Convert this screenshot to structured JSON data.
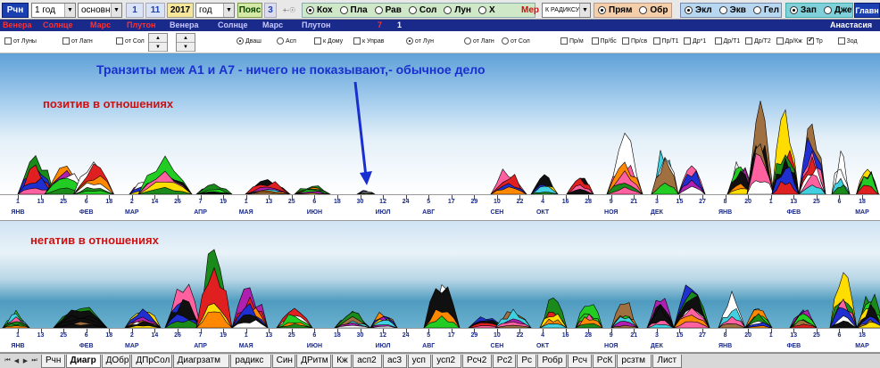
{
  "toolbar": {
    "app_button": "Рчн",
    "period_value": "1 год",
    "mode_value": "основн",
    "day": "1",
    "month": "11",
    "year": "2017",
    "unit_value": "год",
    "belt_label": "Пояс",
    "belt_value": "3",
    "hour_symbol": "+-☉",
    "house_systems": [
      "Кох",
      "Пла",
      "Рав",
      "Сол",
      "Лун",
      "X"
    ],
    "house_selected": "Кох",
    "mer_label": "Мер",
    "radix_value": "К РАДИКСУ",
    "direction": [
      "Прям",
      "Обр"
    ],
    "direction_selected": "Прям",
    "coords": [
      "Экл",
      "Экв",
      "Гел"
    ],
    "coords_selected": "Экл",
    "side": [
      "Зап",
      "Джет"
    ],
    "side_selected": "Зап",
    "main_label": "Главн"
  },
  "planet_row": {
    "left_red": [
      "Венера",
      "Солнце",
      "Марс",
      "Плутон"
    ],
    "left_white": [
      "Плутон",
      "Венера",
      "Солнце",
      "Марс",
      "Плутон"
    ],
    "red_num": "7",
    "white_num": "1",
    "name": "Анастасия"
  },
  "options": {
    "checks": [
      {
        "label": "от Луны",
        "checked": false
      },
      {
        "label": "от Лагн",
        "checked": false
      },
      {
        "label": "от Сол",
        "checked": false
      }
    ],
    "radios": [
      {
        "label": "Дваш",
        "checked": true
      },
      {
        "label": "Асп",
        "checked": false
      }
    ],
    "checks2": [
      {
        "label": "к Дому",
        "checked": false
      },
      {
        "label": "к Управ",
        "checked": false
      }
    ],
    "radios2": [
      {
        "label": "от Лун",
        "checked": true
      },
      {
        "label": "от Лагн",
        "checked": false
      },
      {
        "label": "от Сол",
        "checked": false
      }
    ],
    "checks3": [
      {
        "label": "Пр/м",
        "checked": false
      },
      {
        "label": "Пр/бс",
        "checked": false
      },
      {
        "label": "Пр/св",
        "checked": false
      },
      {
        "label": "Пр/Т1",
        "checked": false
      },
      {
        "label": "Др*1",
        "checked": false
      },
      {
        "label": "Др/Т1",
        "checked": false
      },
      {
        "label": "Др/Т2",
        "checked": false
      },
      {
        "label": "Др/Кж",
        "checked": false
      },
      {
        "label": "Тр",
        "checked": true
      },
      {
        "label": "Зод",
        "checked": false
      }
    ]
  },
  "annotations": {
    "note": "Транзиты  меж А1 и А7 - ничего не показывают,- обычное дело",
    "positive": "позитив в отношениях",
    "negative": "негатив в отношениях"
  },
  "axis": {
    "numbers": [
      "1",
      "13",
      "25",
      "6",
      "18",
      "2",
      "14",
      "26",
      "7",
      "19",
      "1",
      "13",
      "25",
      "6",
      "18",
      "30",
      "12",
      "24",
      "5",
      "17",
      "29",
      "10",
      "22",
      "4",
      "16",
      "28",
      "9",
      "21",
      "3",
      "15",
      "27",
      "8",
      "20",
      "1",
      "13",
      "25",
      "6",
      "18"
    ],
    "months": [
      {
        "label": "ЯНВ",
        "idx": 0
      },
      {
        "label": "ФЕВ",
        "idx": 3
      },
      {
        "label": "МАР",
        "idx": 5
      },
      {
        "label": "АПР",
        "idx": 8
      },
      {
        "label": "МАЯ",
        "idx": 10
      },
      {
        "label": "ИЮН",
        "idx": 13
      },
      {
        "label": "ИЮЛ",
        "idx": 16
      },
      {
        "label": "АВГ",
        "idx": 18
      },
      {
        "label": "СЕН",
        "idx": 21
      },
      {
        "label": "ОКТ",
        "idx": 23
      },
      {
        "label": "НОЯ",
        "idx": 26
      },
      {
        "label": "ДЕК",
        "idx": 28
      },
      {
        "label": "ЯНВ",
        "idx": 31
      },
      {
        "label": "ФЕВ",
        "idx": 34
      },
      {
        "label": "МАР",
        "idx": 37
      }
    ]
  },
  "tabs": [
    "Рчн",
    "Диагр",
    "ДОбр",
    "ДПрСол",
    "Диагрзатм",
    "радикс",
    "Син",
    "ДРитм",
    "Кж",
    "асп2",
    "ас3",
    "усп",
    "усп2",
    "Рсч2",
    "Рс2",
    "Рс",
    "Робр",
    "Рсч",
    "РсК",
    "рсзтм",
    "Лист"
  ],
  "active_tab": "Диагр",
  "colors": {
    "annotation_blue": "#1a2fcf",
    "annotation_red": "#d01010",
    "toolbar_blue": "#1a3fb0"
  }
}
